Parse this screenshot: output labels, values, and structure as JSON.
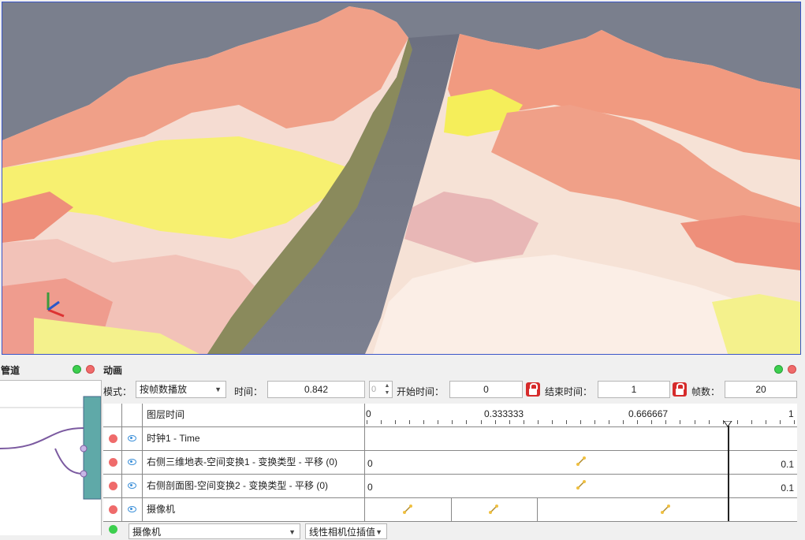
{
  "pipeline": {
    "title": "管道"
  },
  "animation": {
    "title": "动画",
    "mode_label": "模式：",
    "mode_value": "按帧数播放",
    "time_label": "时间：",
    "time_value": "0.842",
    "spin_value": "0",
    "start_label": "开始时间：",
    "start_value": "0",
    "end_label": "结束时间：",
    "end_value": "1",
    "frames_label": "帧数：",
    "frames_value": "20",
    "table": {
      "header": "图层时间",
      "ruler_labels": [
        "0",
        "0.333333",
        "0.666667",
        "1"
      ],
      "playhead_time": 0.842,
      "rows": [
        {
          "name": "时钟1 - Time"
        },
        {
          "name": "右侧三维地表-空间变换1 - 变换类型 - 平移 (0)",
          "start": "0",
          "end": "0.1"
        },
        {
          "name": "右侧剖面图-空间变换2 - 变换类型 - 平移 (0)",
          "start": "0",
          "end": "0.1"
        },
        {
          "name": "摄像机"
        }
      ],
      "add_row": {
        "source": "摄像机",
        "interp": "线性相机位插值"
      }
    }
  },
  "colors": {
    "accent_red": "#ef6b6b",
    "accent_green": "#3ccf4e",
    "lock_red": "#d62b2b"
  }
}
